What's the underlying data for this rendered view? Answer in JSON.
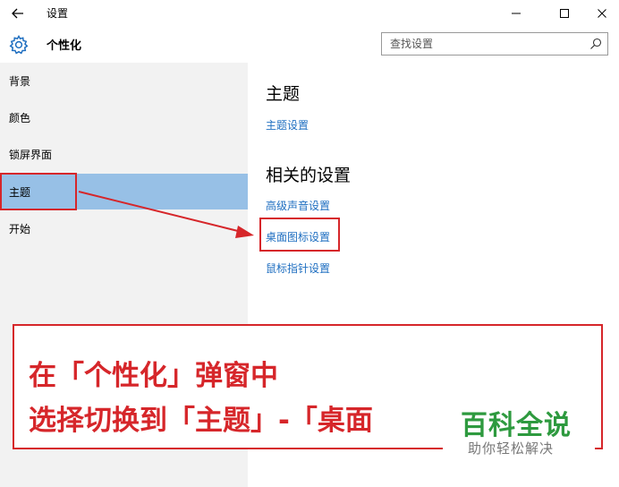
{
  "window": {
    "title": "设置",
    "controls": {
      "minimize": "minimize-icon",
      "maximize": "maximize-icon",
      "close": "close-icon"
    }
  },
  "header": {
    "title": "个性化",
    "search": {
      "placeholder": "查找设置",
      "value": ""
    }
  },
  "sidebar": {
    "items": [
      {
        "label": "背景",
        "selected": false
      },
      {
        "label": "颜色",
        "selected": false
      },
      {
        "label": "锁屏界面",
        "selected": false
      },
      {
        "label": "主题",
        "selected": true
      },
      {
        "label": "开始",
        "selected": false
      }
    ]
  },
  "content": {
    "section_theme": {
      "heading": "主题",
      "link": "主题设置"
    },
    "section_related": {
      "heading": "相关的设置",
      "links": [
        "高级声音设置",
        "桌面图标设置",
        "鼠标指针设置"
      ]
    }
  },
  "annotation": {
    "line1": "在「个性化」弹窗中",
    "line2": "选择切换到「主题」-「桌面",
    "color": "#d6262a"
  },
  "watermark": {
    "main": "百科全说",
    "sub": "助你轻松解决"
  },
  "colors": {
    "selected_bg": "#97c0e6",
    "sidebar_bg": "#f2f2f2",
    "link": "#1e6ec0"
  }
}
